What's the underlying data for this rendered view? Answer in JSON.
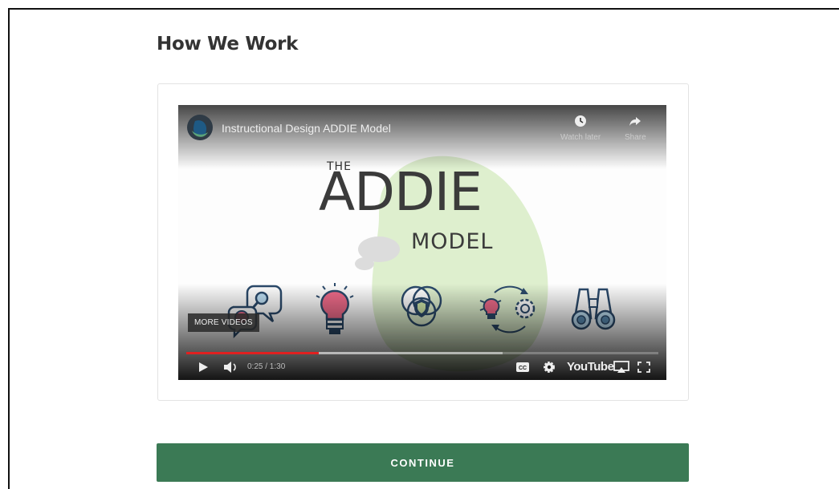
{
  "section": {
    "heading": "How We Work"
  },
  "video": {
    "title": "Instructional Design ADDIE Model",
    "watch_later_label": "Watch later",
    "share_label": "Share",
    "slide": {
      "line1": "THE",
      "line2": "ADDIE",
      "line3": "MODEL"
    },
    "more_videos_label": "MORE VIDEOS",
    "time_display": "0:25 / 1:30",
    "progress_fraction": 0.28,
    "buffered_fraction": 0.67,
    "youtube_logo": "YouTube",
    "icons": [
      "magnifier-speech-icon",
      "lightbulb-icon",
      "venn-shield-icon",
      "lightbulb-gear-cycle-icon",
      "binoculars-icon"
    ],
    "controls": [
      "play-icon",
      "volume-icon",
      "captions-icon",
      "settings-icon",
      "airplay-icon",
      "fullscreen-icon"
    ]
  },
  "actions": {
    "continue_label": "CONTINUE"
  },
  "colors": {
    "continue_bg": "#3b7a55",
    "progress_red": "#e02020",
    "accent_pink": "#ef6b8a",
    "accent_navy": "#2b4a6b",
    "blob_green": "#d8ecc6"
  }
}
